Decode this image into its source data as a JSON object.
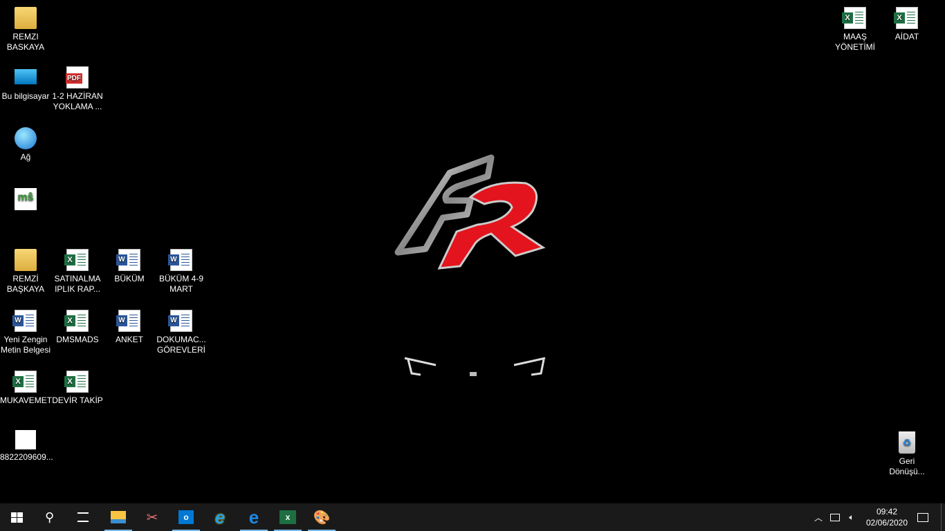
{
  "desktop": {
    "left_icons": [
      {
        "label": "REMZI BASKAYA",
        "type": "user-folder"
      },
      {
        "label": "Bu bilgisayar",
        "type": "computer"
      },
      {
        "label": "1-2 HAZİRAN YOKLAMA ...",
        "type": "pdf"
      },
      {
        "label": "Ağ",
        "type": "network"
      },
      {
        "label": "",
        "type": "shortcut"
      },
      {
        "label": "REMZİ BAŞKAYA",
        "type": "folder"
      },
      {
        "label": "SATINALMA IPLIK RAP...",
        "type": "excel"
      },
      {
        "label": "BÜKÜM",
        "type": "word"
      },
      {
        "label": "BÜKÜM 4-9 MART",
        "type": "word"
      },
      {
        "label": "Yeni Zengin Metin Belgesi",
        "type": "word"
      },
      {
        "label": "DMSMADS",
        "type": "excel"
      },
      {
        "label": "ANKET",
        "type": "word"
      },
      {
        "label": "DOKUMAC... GÖREVLERİ",
        "type": "word"
      },
      {
        "label": "MUKAVEMET",
        "type": "excel"
      },
      {
        "label": "DEVİR TAKİP",
        "type": "excel"
      },
      {
        "label": "8822209609...",
        "type": "image"
      }
    ],
    "right_icons": [
      {
        "label": "MAAŞ YÖNETİMİ",
        "type": "excel"
      },
      {
        "label": "AİDAT",
        "type": "excel"
      },
      {
        "label": "Geri Dönüşü...",
        "type": "recycle-bin"
      }
    ]
  },
  "taskbar": {
    "apps": [
      "start",
      "search",
      "task-view",
      "file-explorer",
      "snipping-tool",
      "outlook",
      "internet-explorer",
      "edge",
      "excel",
      "paint"
    ],
    "clock": {
      "time": "09:42",
      "date": "02/06/2020"
    }
  },
  "colors": {
    "taskbar": "#1a1a1a",
    "accent": "#76b9ed",
    "logo_red": "#e3141d"
  }
}
